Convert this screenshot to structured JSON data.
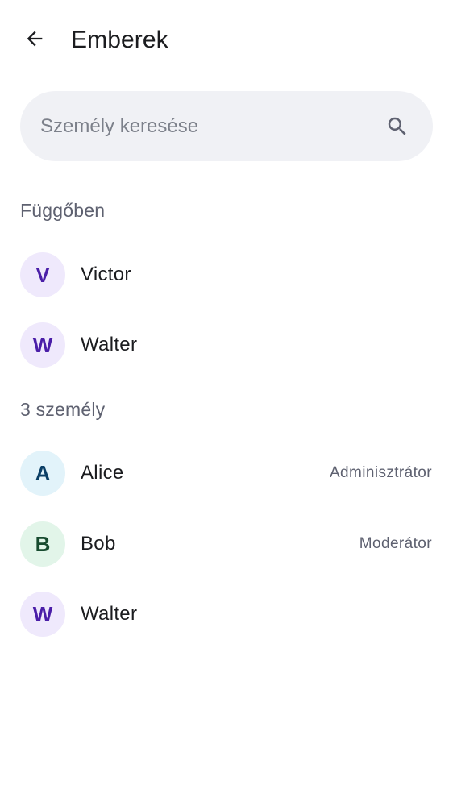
{
  "header": {
    "title": "Emberek",
    "back_icon": "arrow-left-icon"
  },
  "search": {
    "placeholder": "Személy keresése",
    "value": "",
    "icon": "search-icon"
  },
  "sections": {
    "pending": {
      "title": "Függőben",
      "members": [
        {
          "initial": "V",
          "name": "Victor",
          "role": "",
          "avatar_color": "#efe9fc",
          "initial_color": "#4a1ea8"
        },
        {
          "initial": "W",
          "name": "Walter",
          "role": "",
          "avatar_color": "#efe9fc",
          "initial_color": "#4a1ea8"
        }
      ]
    },
    "joined": {
      "title": "3 személy",
      "members": [
        {
          "initial": "A",
          "name": "Alice",
          "role": "Adminisztrátor",
          "avatar_color": "#e2f3fa",
          "initial_color": "#0b3f66"
        },
        {
          "initial": "B",
          "name": "Bob",
          "role": "Moderátor",
          "avatar_color": "#e2f5e9",
          "initial_color": "#174b2f"
        },
        {
          "initial": "W",
          "name": "Walter",
          "role": "",
          "avatar_color": "#efe9fc",
          "initial_color": "#4a1ea8"
        }
      ]
    }
  }
}
